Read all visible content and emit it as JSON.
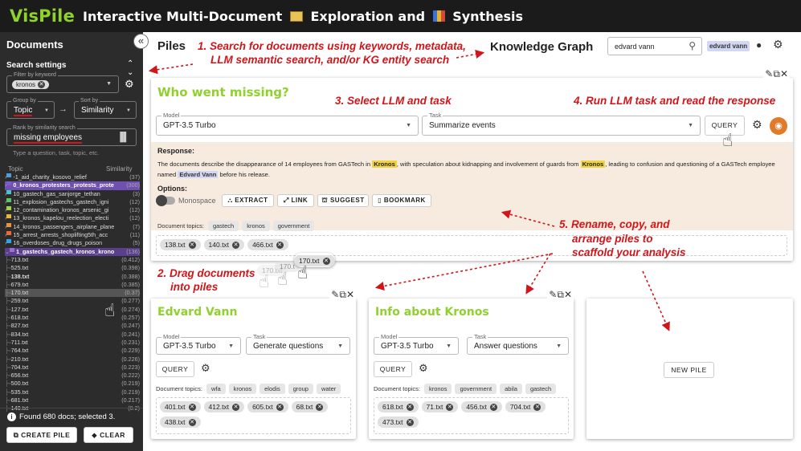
{
  "app": {
    "name": "VisPile",
    "subtitle_a": "Interactive Multi-Document",
    "subtitle_b": "Exploration and",
    "subtitle_c": "Synthesis",
    "book_icon": "book-emoji-icon",
    "chart_icon": "chart-emoji-icon"
  },
  "colors": {
    "accent_green": "#8fd12d",
    "annotation_red": "#d0161a",
    "highlight_yellow": "#f1d33f",
    "highlight_purple": "#d4d7f3",
    "response_bg": "#f7ebe0"
  },
  "sidebar": {
    "title": "Documents",
    "collapse_glyph": "«",
    "search_settings": "Search settings",
    "filter_label": "Filter by keyword",
    "filter_chip": "kronos",
    "group_label": "Group by",
    "group_value": "Topic",
    "sort_label": "Sort by",
    "sort_value": "Similarity",
    "rank_label": "Rank by similarity search",
    "rank_value": "missing employees",
    "rank_hint": "Type a question, task, topic, etc.",
    "col_topic": "Topic",
    "col_similarity": "Similarity",
    "topics": [
      {
        "name": "-1_aid_charity_kosovo_relief",
        "score": "(37)",
        "color": "#4d9de0"
      },
      {
        "name": "0_kronos_protesters_protests_prote",
        "score": "(300)",
        "color": "#7b5ec9",
        "selected": true
      },
      {
        "name": "10_gastech_gas_sanjorge_tethan",
        "score": "(3)",
        "color": "#4dc1c9"
      },
      {
        "name": "11_explosion_gastechs_gastech_igni",
        "score": "(12)",
        "color": "#5cc26b"
      },
      {
        "name": "12_contamination_kronos_arsenic_gi",
        "score": "(12)",
        "color": "#a5d04d"
      },
      {
        "name": "13_kronos_kapelou_reelection_electi",
        "score": "(12)",
        "color": "#e4b93a"
      },
      {
        "name": "14_kronos_passengers_airplane_plane",
        "score": "(7)",
        "color": "#e8953a"
      },
      {
        "name": "15_arrest_arrests_shoplifting5th_acc",
        "score": "(11)",
        "color": "#e86b3a"
      },
      {
        "name": "16_overdoses_drug_drugs_poison",
        "score": "(5)",
        "color": "#3aa0e8"
      },
      {
        "name": "1_gastechs_gastech_kronos_krono",
        "score": "(136)",
        "color": "#9f6bd4",
        "expanded": true
      }
    ],
    "docs": [
      {
        "name": "713.txt",
        "score": "(0.412)"
      },
      {
        "name": "525.txt",
        "score": "(0.398)"
      },
      {
        "name": "138.txt",
        "score": "(0.388)",
        "bold": true
      },
      {
        "name": "679.txt",
        "score": "(0.385)"
      },
      {
        "name": "170.txt",
        "score": "(0.37)",
        "selected": true
      },
      {
        "name": "259.txt",
        "score": "(0.277)"
      },
      {
        "name": "127.txt",
        "score": "(0.274)"
      },
      {
        "name": "618.txt",
        "score": "(0.257)"
      },
      {
        "name": "827.txt",
        "score": "(0.247)"
      },
      {
        "name": "834.txt",
        "score": "(0.241)"
      },
      {
        "name": "711.txt",
        "score": "(0.231)"
      },
      {
        "name": "764.txt",
        "score": "(0.229)"
      },
      {
        "name": "210.txt",
        "score": "(0.226)"
      },
      {
        "name": "704.txt",
        "score": "(0.223)"
      },
      {
        "name": "656.txt",
        "score": "(0.222)"
      },
      {
        "name": "500.txt",
        "score": "(0.219)"
      },
      {
        "name": "535.txt",
        "score": "(0.219)"
      },
      {
        "name": "681.txt",
        "score": "(0.217)"
      },
      {
        "name": "140.txt",
        "score": "(0.2)"
      }
    ],
    "found": "Found 680 docs; selected 3.",
    "create_pile": "CREATE PILE",
    "clear": "CLEAR"
  },
  "header": {
    "piles": "Piles",
    "knowledge_graph": "Knowledge Graph",
    "search_value": "edvard vann",
    "entity_chip": "edvard vann"
  },
  "annotations": {
    "a1_l1": "1. Search for documents using keywords, metadata,",
    "a1_l2": "LLM semantic search, and/or KG entity search",
    "a2_l1": "2. Drag documents",
    "a2_l2": "into piles",
    "a3": "3. Select LLM and task",
    "a4": "4. Run LLM task and read the response",
    "a5_l1": "5. Rename, copy, and",
    "a5_l2": "arrange piles to",
    "a5_l3": "scaffold your analysis"
  },
  "main_pile": {
    "title": "Who went missing?",
    "model_label": "Model",
    "model_value": "GPT-3.5 Turbo",
    "task_label": "Task",
    "task_value": "Summarize events",
    "query": "QUERY",
    "response_label": "Response:",
    "response_p1": "The documents describe the disappearance of 14 employees from GASTech in",
    "response_hl1": "Kronos",
    "response_p2": ", with speculation about kidnapping and involvement of guards from",
    "response_hl2": "Kronos",
    "response_p3": ", leading to confusion and questioning of a GASTech employee",
    "response_p4": "named",
    "response_hl3": "Edvard Vann",
    "response_p5": "before his release.",
    "options_label": "Options:",
    "monospace": "Monospace",
    "extract": "EXTRACT",
    "link": "LINK",
    "suggest": "SUGGEST",
    "bookmark": "BOOKMARK",
    "topics_label": "Document topics:",
    "topics": [
      "gastech",
      "kronos",
      "government"
    ],
    "docs": [
      "138.txt",
      "140.txt",
      "466.txt"
    ],
    "drag_doc": "170.txt",
    "ghost_docs": [
      "170.txt",
      "170.t"
    ]
  },
  "pile_edvard": {
    "title": "Edvard Vann",
    "model_label": "Model",
    "model_value": "GPT-3.5 Turbo",
    "task_label": "Task",
    "task_value": "Generate questions",
    "query": "QUERY",
    "topics_label": "Document topics:",
    "topics": [
      "wfa",
      "kronos",
      "elodis",
      "group",
      "water"
    ],
    "docs": [
      "401.txt",
      "412.txt",
      "605.txt",
      "68.txt",
      "438.txt"
    ]
  },
  "pile_kronos": {
    "title": "Info about Kronos",
    "model_label": "Model",
    "model_value": "GPT-3.5 Turbo",
    "task_label": "Task",
    "task_value": "Answer questions",
    "query": "QUERY",
    "topics_label": "Document topics:",
    "topics": [
      "kronos",
      "government",
      "abila",
      "gastech"
    ],
    "docs": [
      "618.txt",
      "71.txt",
      "456.txt",
      "704.txt",
      "473.txt"
    ]
  },
  "new_pile": "NEW PILE"
}
